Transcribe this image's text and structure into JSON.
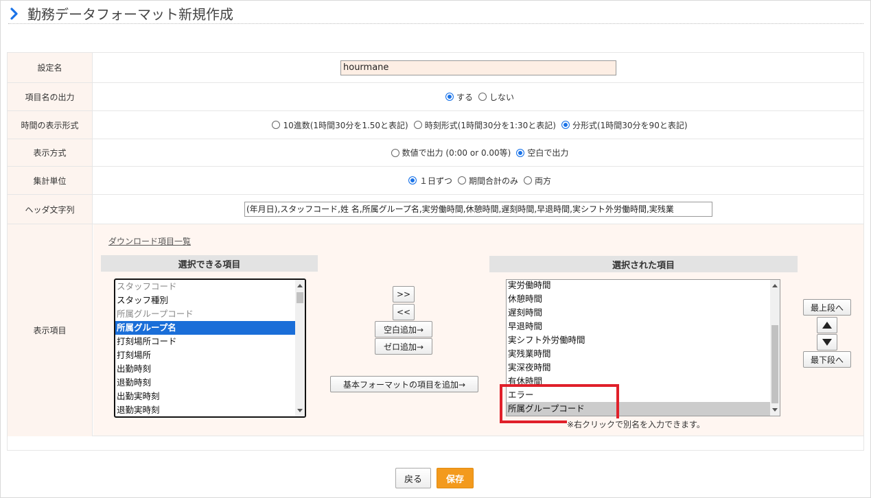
{
  "page": {
    "title": "勤務データフォーマット新規作成"
  },
  "colors": {
    "accent": "#1a73e8",
    "save": "#f39a1d",
    "highlight": "#e0202a",
    "selected": "#1a6ed8"
  },
  "icons": {
    "title": "chevron-right-icon"
  },
  "form": {
    "setting_name": {
      "label": "設定名",
      "value": "hourmane"
    },
    "item_name_output": {
      "label": "項目名の出力",
      "options": [
        {
          "label": "する",
          "selected": true
        },
        {
          "label": "しない",
          "selected": false
        }
      ]
    },
    "time_format": {
      "label": "時間の表示形式",
      "options": [
        {
          "label": "10進数(1時間30分を1.50と表記)",
          "selected": false
        },
        {
          "label": "時刻形式(1時間30分を1:30と表記)",
          "selected": false
        },
        {
          "label": "分形式(1時間30分を90と表記)",
          "selected": true
        }
      ]
    },
    "display_mode": {
      "label": "表示方式",
      "options": [
        {
          "label": "数値で出力 (0:00 or 0.00等)",
          "selected": false
        },
        {
          "label": "空白で出力",
          "selected": true
        }
      ]
    },
    "aggregation_unit": {
      "label": "集計単位",
      "options": [
        {
          "label": "１日ずつ",
          "selected": true
        },
        {
          "label": "期間合計のみ",
          "selected": false
        },
        {
          "label": "両方",
          "selected": false
        }
      ]
    },
    "header_string": {
      "label": "ヘッダ文字列",
      "value": "(年月日),スタッフコード,姓 名,所属グループ名,実労働時間,休憩時間,遅刻時間,早退時間,実シフト外労働時間,実残業"
    },
    "display_items": {
      "label": "表示項目",
      "download_link": "ダウンロード項目一覧",
      "available": {
        "heading": "選択できる項目",
        "items": [
          {
            "text": "スタッフコード",
            "state": "dim"
          },
          {
            "text": "スタッフ種別",
            "state": "normal"
          },
          {
            "text": "所属グループコード",
            "state": "dim"
          },
          {
            "text": "所属グループ名",
            "state": "selected"
          },
          {
            "text": "打刻場所コード",
            "state": "normal"
          },
          {
            "text": "打刻場所",
            "state": "normal"
          },
          {
            "text": "出勤時刻",
            "state": "normal"
          },
          {
            "text": "退勤時刻",
            "state": "normal"
          },
          {
            "text": "出勤実時刻",
            "state": "normal"
          },
          {
            "text": "退勤実時刻",
            "state": "normal"
          }
        ]
      },
      "selected": {
        "heading": "選択された項目",
        "items": [
          {
            "text": "実労働時間",
            "state": "normal"
          },
          {
            "text": "休憩時間",
            "state": "normal"
          },
          {
            "text": "遅刻時間",
            "state": "normal"
          },
          {
            "text": "早退時間",
            "state": "normal"
          },
          {
            "text": "実シフト外労働時間",
            "state": "normal"
          },
          {
            "text": "実残業時間",
            "state": "normal"
          },
          {
            "text": "実深夜時間",
            "state": "normal"
          },
          {
            "text": "有休時間",
            "state": "normal"
          },
          {
            "text": "エラー",
            "state": "normal"
          },
          {
            "text": "所属グループコード",
            "state": "grey"
          }
        ],
        "note": "※右クリックで別名を入力できます。"
      },
      "buttons": {
        "add": ">>",
        "remove": "<<",
        "add_blank": "空白追加→",
        "add_zero": "ゼロ追加→",
        "add_basic": "基本フォーマットの項目を追加→",
        "to_top": "最上段へ",
        "to_bottom": "最下段へ"
      }
    }
  },
  "footer": {
    "back": "戻る",
    "save": "保存"
  }
}
